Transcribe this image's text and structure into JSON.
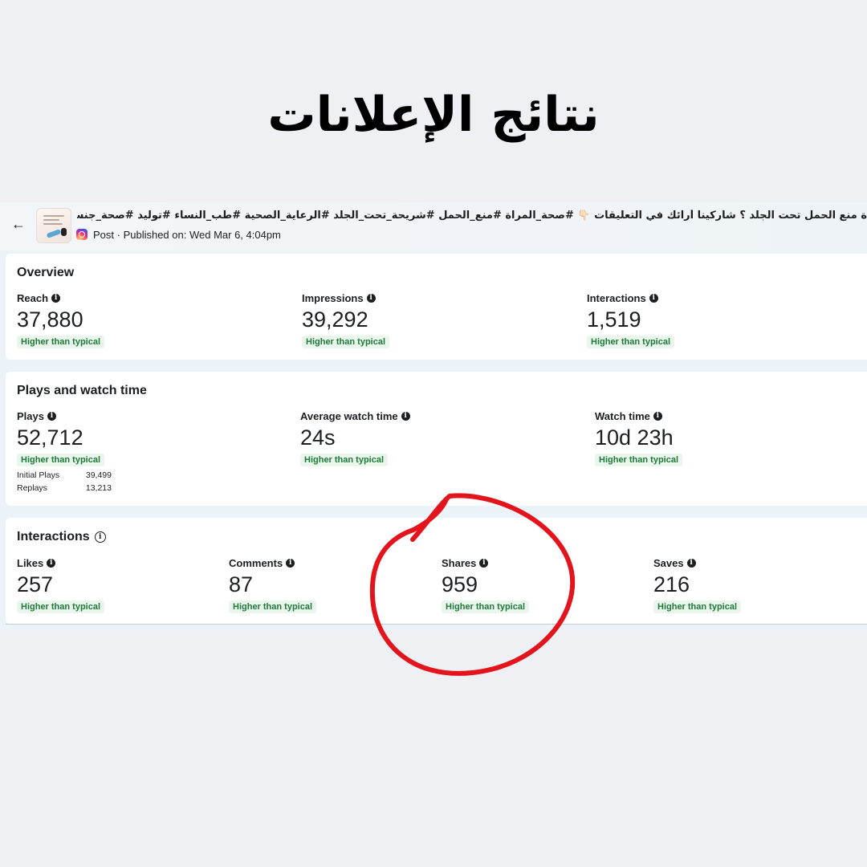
{
  "page_heading": "نتائج الإعلانات",
  "post": {
    "caption": "ة منع الحمل تحت الجلد ؟ شاركينا أرائك في التعليقات 👇🏻 #صحة_المراة #منع_الحمل #شريحة_تحت_الجلد #الرعاية_الصحية #طب_النساء #توليد #صحة_جنسية #جدة #السعودية",
    "meta": "Post · Published on: Wed Mar 6, 4:04pm",
    "platform_icon": "instagram-icon",
    "back_icon": "arrow-left-icon"
  },
  "overview": {
    "title": "Overview",
    "metrics": [
      {
        "label": "Reach",
        "value": "37,880",
        "badge": "Higher than typical"
      },
      {
        "label": "Impressions",
        "value": "39,292",
        "badge": "Higher than typical"
      },
      {
        "label": "Interactions",
        "value": "1,519",
        "badge": "Higher than typical"
      }
    ]
  },
  "plays": {
    "title": "Plays and watch time",
    "metrics": [
      {
        "label": "Plays",
        "value": "52,712",
        "badge": "Higher than typical"
      },
      {
        "label": "Average watch time",
        "value": "24s",
        "badge": "Higher than typical"
      },
      {
        "label": "Watch time",
        "value": "10d 23h",
        "badge": "Higher than typical"
      }
    ],
    "breakdown": [
      {
        "label": "Initial Plays",
        "value": "39,499"
      },
      {
        "label": "Replays",
        "value": "13,213"
      }
    ]
  },
  "interactions": {
    "title": "Interactions",
    "metrics": [
      {
        "label": "Likes",
        "value": "257",
        "badge": "Higher than typical"
      },
      {
        "label": "Comments",
        "value": "87",
        "badge": "Higher than typical"
      },
      {
        "label": "Shares",
        "value": "959",
        "badge": "Higher than typical"
      },
      {
        "label": "Saves",
        "value": "216",
        "badge": "Higher than typical"
      }
    ]
  },
  "colors": {
    "badge_bg": "#eaf6ec",
    "badge_text": "#1d7a3a",
    "highlight_circle": "#e3141b"
  }
}
